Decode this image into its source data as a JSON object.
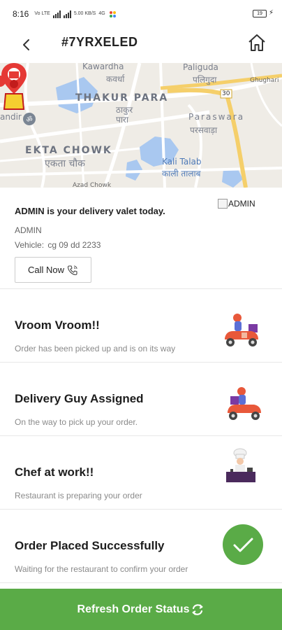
{
  "status_bar": {
    "time": "8:16",
    "volte": "Vo LTE",
    "speed": "5.00 KB/S",
    "net": "4G",
    "battery": "19"
  },
  "header": {
    "order_id": "#7YRXELED",
    "icons": {
      "back": "chevron-left-icon",
      "home": "home-icon"
    }
  },
  "map": {
    "labels": {
      "kawardha_en": "Kawardha",
      "kawardha_hi": "कवर्धा",
      "paliguda_en": "Paliguda",
      "paliguda_hi": "पलिगुदा",
      "ghughari": "Ghughari",
      "thakur_en": "THAKUR PARA",
      "thakur_hi_1": "ठाकुर",
      "thakur_hi_2": "पारा",
      "paraswara_en": "Paraswara",
      "paraswara_hi": "परसवाड़ा",
      "mandir": "andir",
      "ekta_en": "EKTA CHOWK",
      "ekta_hi": "एकता चौक",
      "kali_en": "Kali Talab",
      "kali_hi": "काली तालाब",
      "azad": "Azad Chowk",
      "road_num": "30"
    }
  },
  "valet": {
    "title": "ADMIN is your delivery valet today.",
    "name": "ADMIN",
    "vehicle_label": "Vehicle:",
    "vehicle": "cg 09 dd 2233",
    "call_label": "Call Now",
    "image_alt": "ADMIN"
  },
  "steps": [
    {
      "title": "Vroom Vroom!!",
      "desc": "Order has been picked up and is on its way",
      "icon": "delivery-scooter-icon"
    },
    {
      "title": "Delivery Guy Assigned",
      "desc": "On the way to pick up your order.",
      "icon": "delivery-scooter-icon"
    },
    {
      "title": "Chef at work!!",
      "desc": "Restaurant is preparing your order",
      "icon": "chef-icon"
    },
    {
      "title": "Order Placed Successfully",
      "desc": "Waiting for the restaurant to confirm your order",
      "icon": "check-icon"
    }
  ],
  "refresh": {
    "label": "Refresh Order Status"
  },
  "colors": {
    "accent": "#5aab47",
    "scooter": "#e8583a",
    "map_water": "#a9c8f0",
    "map_road": "#ffffff",
    "highway": "#f5cf6a"
  }
}
